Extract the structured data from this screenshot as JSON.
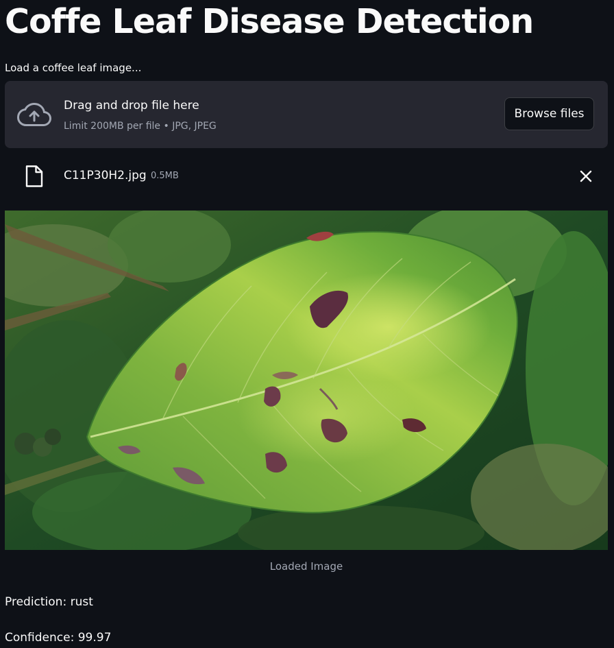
{
  "app": {
    "title": "Coffe Leaf Disease Detection"
  },
  "uploader": {
    "label": "Load a coffee leaf image...",
    "drop_title": "Drag and drop file here",
    "drop_limit": "Limit 200MB per file • JPG, JPEG",
    "browse_label": "Browse files",
    "icon": "cloud-upload-icon"
  },
  "uploaded_file": {
    "name": "C11P30H2.jpg",
    "size": "0.5MB",
    "icon": "file-icon",
    "remove_icon": "close-icon"
  },
  "image": {
    "caption": "Loaded Image"
  },
  "result": {
    "prediction": "Prediction: rust",
    "confidence": "Confidence: 99.97"
  },
  "colors": {
    "background": "#0e1117",
    "panel": "#262730",
    "text": "#fafafa",
    "muted_text": "#a3a8b4"
  }
}
